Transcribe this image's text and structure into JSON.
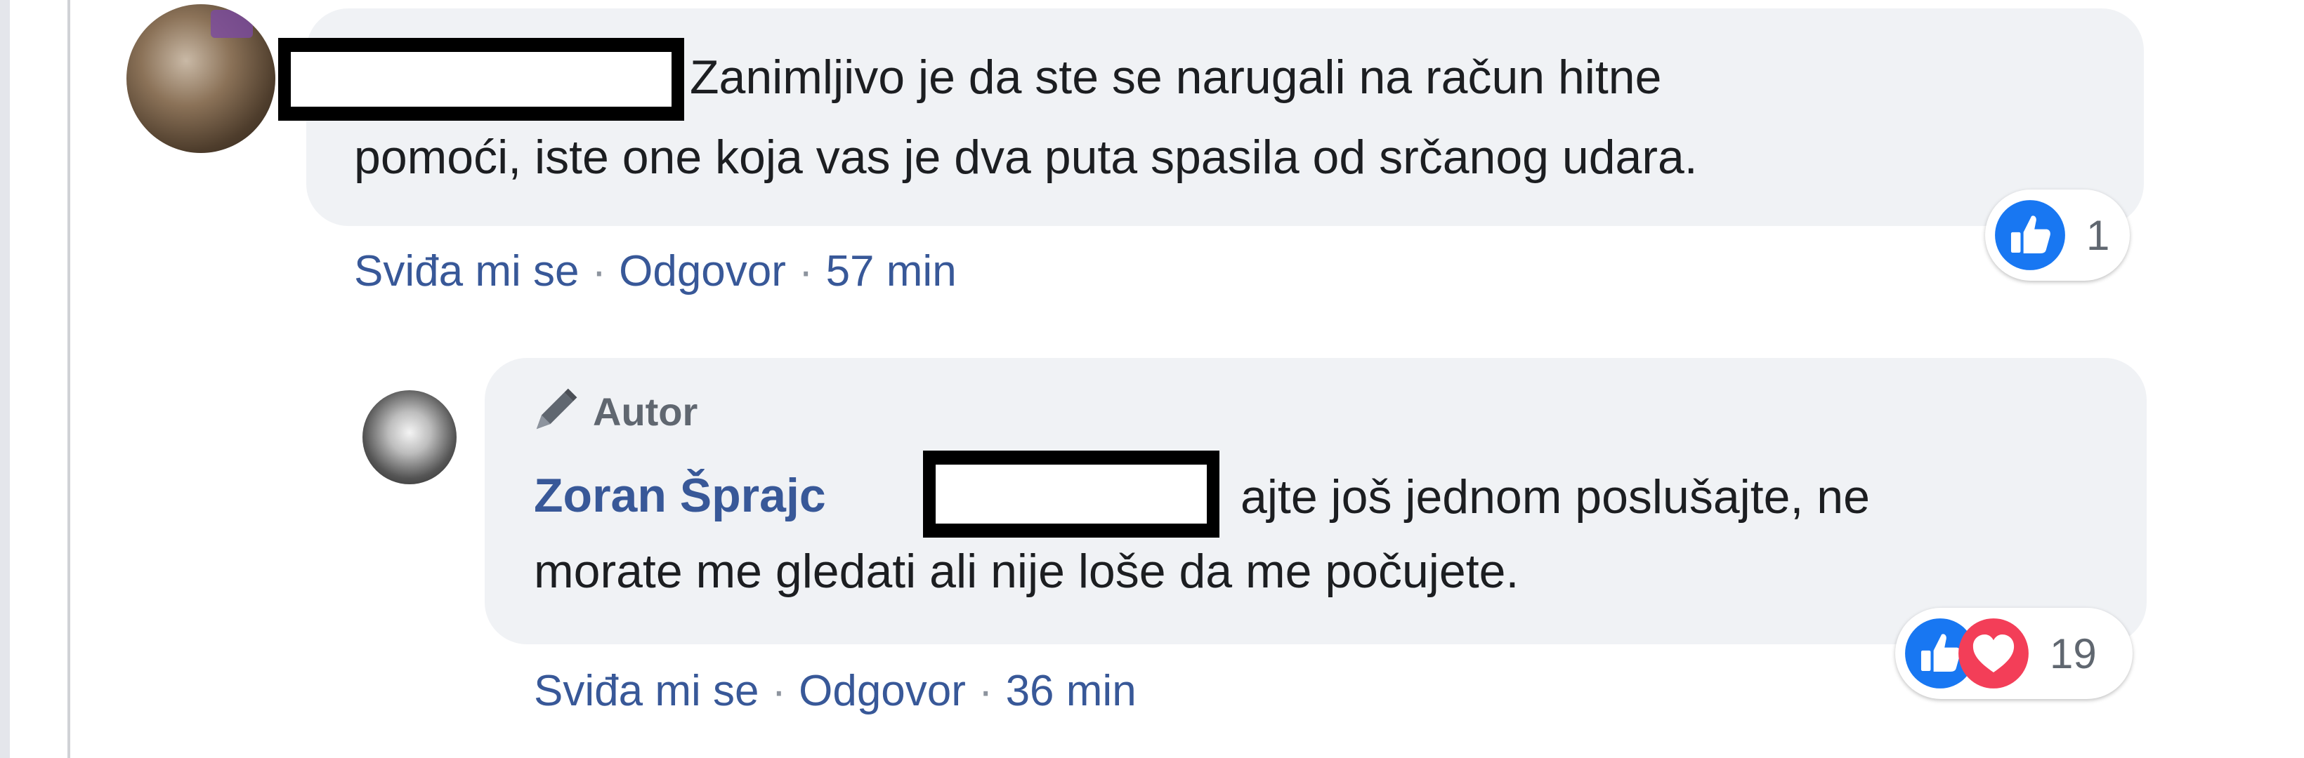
{
  "colors": {
    "bubble_bg": "#f0f2f5",
    "link": "#385898",
    "like_blue": "#1877f2",
    "love_red": "#f33e58"
  },
  "comments": [
    {
      "author": "",
      "author_redacted": true,
      "text_line1": "Zanimljivo je da ste se narugali na račun hitne",
      "text_line2": "pomoći, iste one koja vas je dva puta spasila od srčanog udara.",
      "actions": {
        "like": "Sviđa mi se",
        "sep": "·",
        "reply": "Odgovor",
        "time": "57 min"
      },
      "reactions": {
        "icons": [
          "like-icon"
        ],
        "count": "1"
      }
    },
    {
      "badge": "Autor",
      "badge_icon": "pencil-icon",
      "author": "Zoran Šprajc",
      "mention_redacted": true,
      "text_line1": "ajte još jednom poslušajte, ne",
      "text_line2": "morate me gledati ali nije loše da me počujete.",
      "actions": {
        "like": "Sviđa mi se",
        "sep": "·",
        "reply": "Odgovor",
        "time": "36 min"
      },
      "reactions": {
        "icons": [
          "like-icon",
          "love-icon"
        ],
        "count": "19"
      }
    }
  ]
}
